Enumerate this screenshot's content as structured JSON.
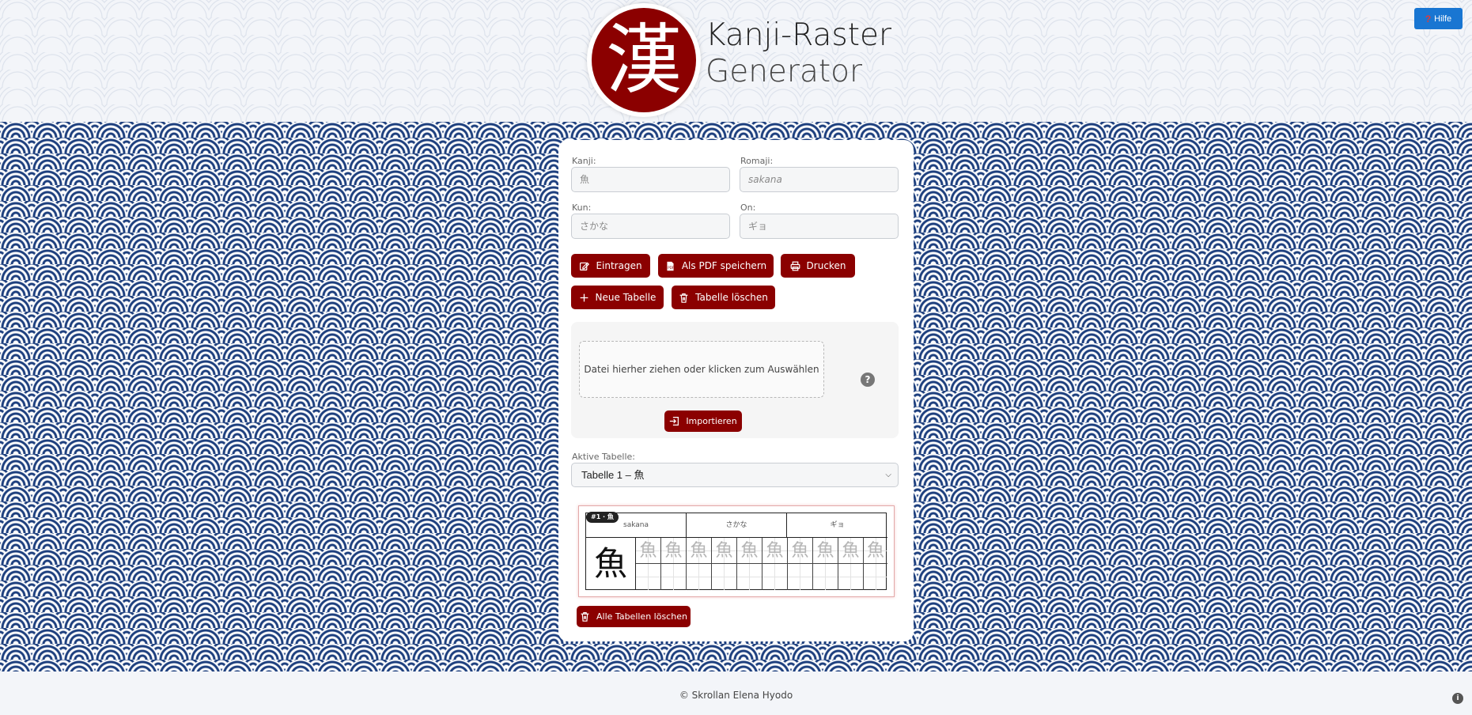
{
  "header": {
    "logo_char": "漢",
    "title_line1": "Kanji-Raster",
    "title_line2": "Generator",
    "help_label": "Hilfe"
  },
  "form": {
    "kanji_label": "Kanji:",
    "kanji_placeholder": "魚",
    "romaji_label": "Romaji:",
    "romaji_placeholder": "sakana",
    "kun_label": "Kun:",
    "kun_placeholder": "さかな",
    "on_label": "On:",
    "on_placeholder": "ギョ"
  },
  "buttons": {
    "eintragen": "Eintragen",
    "pdf": "Als PDF speichern",
    "drucken": "Drucken",
    "neue_tabelle": "Neue Tabelle",
    "tabelle_loeschen": "Tabelle löschen"
  },
  "import": {
    "dropzone_text": "Datei hierher ziehen oder klicken zum Auswählen",
    "help_icon": "?",
    "import_label": "Importieren"
  },
  "active_table": {
    "label": "Aktive Tabelle:",
    "selected": "Tabelle 1 – 魚"
  },
  "preview": {
    "badge": "#1 · 魚",
    "romaji": "sakana",
    "kun": "さかな",
    "on": "ギョ",
    "kanji": "魚",
    "trace_char": "魚"
  },
  "delete_all_label": "Alle Tabellen löschen",
  "footer": {
    "copyright": "© Skrollan Elena Hyodo",
    "info_icon": "i"
  },
  "colors": {
    "accent": "#8b0000",
    "help_blue": "#1976d2",
    "pattern_navy": "#1d3f7e"
  }
}
